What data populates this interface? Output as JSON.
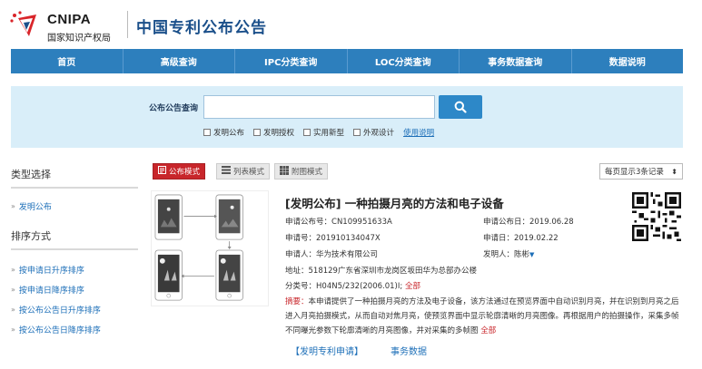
{
  "header": {
    "logo_en": "CNIPA",
    "logo_cn": "国家知识产权局",
    "site_title": "中国专利公布公告"
  },
  "nav": [
    "首页",
    "高级查询",
    "IPC分类查询",
    "LOC分类查询",
    "事务数据查询",
    "数据说明"
  ],
  "search": {
    "label": "公布公告查询",
    "value": "",
    "filters": [
      "发明公布",
      "发明授权",
      "实用新型",
      "外观设计"
    ],
    "help": "使用说明"
  },
  "sidebar": {
    "type_heading": "类型选择",
    "type_items": [
      "发明公布"
    ],
    "sort_heading": "排序方式",
    "sort_items": [
      "按申请日升序排序",
      "按申请日降序排序",
      "按公布公告日升序排序",
      "按公布公告日降序排序"
    ]
  },
  "toolbar": {
    "modes": [
      "公布模式",
      "列表模式",
      "附图模式"
    ],
    "per_page": "每页显示3条记录"
  },
  "result": {
    "title": "[发明公布] 一种拍摄月亮的方法和电子设备",
    "pub_no_label": "申请公布号：",
    "pub_no": "CN109951633A",
    "pub_date_label": "申请公布日：",
    "pub_date": "2019.06.28",
    "app_no_label": "申请号：",
    "app_no": "201910134047X",
    "app_date_label": "申请日：",
    "app_date": "2019.02.22",
    "applicant_label": "申请人：",
    "applicant": "华为技术有限公司",
    "inventor_label": "发明人：",
    "inventor": "陈彬",
    "address_label": "地址：",
    "address": "518129广东省深圳市龙岗区坂田华为总部办公楼",
    "class_label": "分类号：",
    "class": "H04N5/232(2006.01)I;",
    "class_all": "全部",
    "abstract_label": "摘要：",
    "abstract": "本申请提供了一种拍摄月亮的方法及电子设备，该方法通过在预览界面中自动识别月亮，并在识别到月亮之后进入月亮拍摄模式，从而自动对焦月亮，使预览界面中显示轮廓清晰的月亮图像。再根据用户的拍摄操作，采集多帧不同曝光参数下轮廓清晰的月亮图像，并对采集的多帧图",
    "abstract_all": "全部",
    "links": [
      "【发明专利申请】",
      "事务数据"
    ]
  },
  "colors": {
    "nav_blue": "#2d7fbd",
    "band_blue": "#d9eef9",
    "accent_red": "#c8262b",
    "link_blue": "#1d6fb8"
  }
}
